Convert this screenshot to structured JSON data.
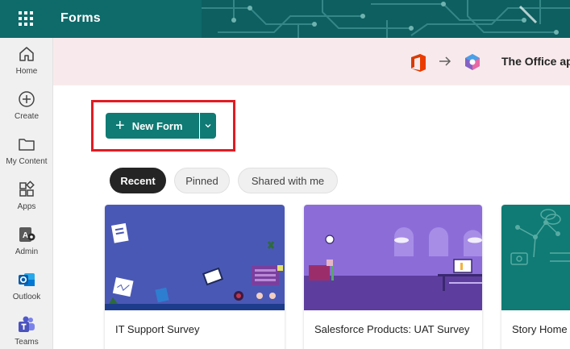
{
  "header": {
    "app_title": "Forms",
    "waffle_icon": "app-launcher-icon",
    "color": "#0f6a6a"
  },
  "rail": {
    "items": [
      {
        "label": "Home",
        "icon": "home-icon"
      },
      {
        "label": "Create",
        "icon": "plus-circle-icon"
      },
      {
        "label": "My Content",
        "icon": "folder-icon"
      },
      {
        "label": "Apps",
        "icon": "apps-icon"
      },
      {
        "label": "Admin",
        "icon": "admin-icon"
      },
      {
        "label": "Outlook",
        "icon": "outlook-icon"
      },
      {
        "label": "Teams",
        "icon": "teams-icon"
      }
    ]
  },
  "banner": {
    "text": "The Office ap",
    "background": "#f8eaec"
  },
  "toolbar": {
    "new_form_label": "New Form",
    "accent": "#0f7b74"
  },
  "tabs": [
    {
      "label": "Recent",
      "active": true
    },
    {
      "label": "Pinned",
      "active": false
    },
    {
      "label": "Shared with me",
      "active": false
    }
  ],
  "cards": [
    {
      "title": "IT Support Survey",
      "theme": "blue-office"
    },
    {
      "title": "Salesforce Products: UAT Survey",
      "theme": "purple-room"
    },
    {
      "title": "Story Home",
      "theme": "teal-network"
    }
  ]
}
